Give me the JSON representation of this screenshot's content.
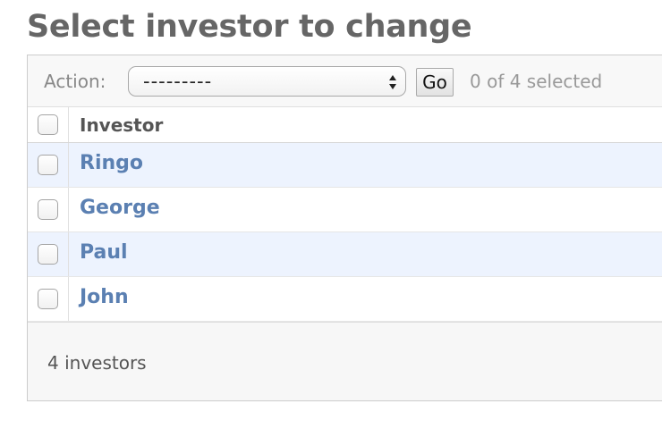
{
  "page": {
    "title": "Select investor to change"
  },
  "actions": {
    "label": "Action:",
    "selected_value": "---------",
    "go_label": "Go",
    "selection_counter": "0 of 4 selected"
  },
  "table": {
    "column_header": "Investor",
    "rows": [
      {
        "name": "Ringo",
        "checked": false
      },
      {
        "name": "George",
        "checked": false
      },
      {
        "name": "Paul",
        "checked": false
      },
      {
        "name": "John",
        "checked": false
      }
    ]
  },
  "paginator": {
    "result_count": "4 investors"
  },
  "colors": {
    "title": "#666666",
    "link": "#5b80b2",
    "row_highlight": "#edf3fe",
    "toolbar_background": "#f8f8f8"
  },
  "icons": {
    "select_arrows": "up-down-arrows-icon"
  }
}
